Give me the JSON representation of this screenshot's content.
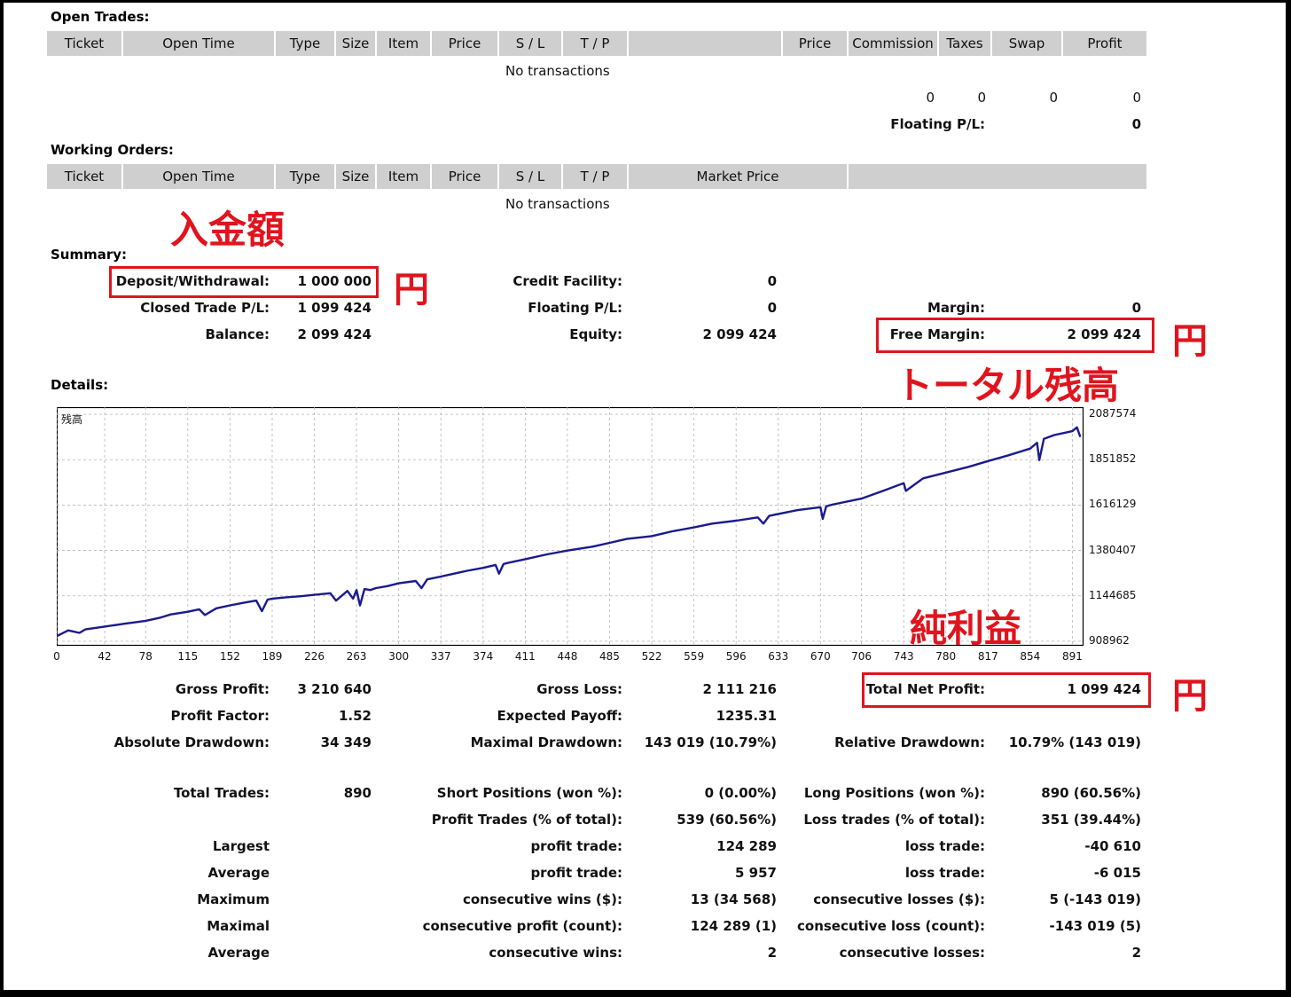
{
  "open_trades": {
    "title": "Open Trades:",
    "columns": [
      "Ticket",
      "Open Time",
      "Type",
      "Size",
      "Item",
      "Price",
      "S / L",
      "T / P",
      "",
      "Price",
      "Commission",
      "Taxes",
      "Swap",
      "Profit"
    ],
    "empty_text": "No transactions",
    "totals": [
      "0",
      "0",
      "0",
      "0"
    ],
    "floating_label": "Floating P/L:",
    "floating_value": "0"
  },
  "working_orders": {
    "title": "Working Orders:",
    "columns": [
      "Ticket",
      "Open Time",
      "Type",
      "Size",
      "Item",
      "Price",
      "S / L",
      "T / P",
      "Market Price",
      ""
    ],
    "empty_text": "No transactions"
  },
  "annotations": {
    "deposit_note": "入金額",
    "yen": "円",
    "total_balance_note": "トータル残高",
    "net_profit_note": "純利益"
  },
  "summary": {
    "title": "Summary:",
    "deposit_label": "Deposit/Withdrawal:",
    "deposit_value": "1 000 000",
    "closed_label": "Closed Trade P/L:",
    "closed_value": "1 099 424",
    "balance_label": "Balance:",
    "balance_value": "2 099 424",
    "credit_label": "Credit Facility:",
    "credit_value": "0",
    "floating_label": "Floating P/L:",
    "floating_value": "0",
    "equity_label": "Equity:",
    "equity_value": "2 099 424",
    "margin_label": "Margin:",
    "margin_value": "0",
    "free_margin_label": "Free Margin:",
    "free_margin_value": "2 099 424"
  },
  "details": {
    "title": "Details:",
    "chart_tag": "残高"
  },
  "chart_data": {
    "type": "line",
    "ylabel": "残高",
    "y_ticks": [
      2087574,
      1851852,
      1616129,
      1380407,
      1144685,
      908962
    ],
    "x_ticks": [
      0,
      42,
      78,
      115,
      152,
      189,
      226,
      263,
      300,
      337,
      374,
      411,
      448,
      485,
      522,
      559,
      596,
      633,
      670,
      706,
      743,
      780,
      817,
      854,
      891
    ],
    "xlim": [
      0,
      900
    ],
    "ylim": [
      890000,
      2125000
    ],
    "grid": true,
    "series": [
      {
        "color": "#1a1a8c",
        "x": [
          0,
          10,
          20,
          25,
          42,
          60,
          78,
          90,
          100,
          115,
          125,
          130,
          140,
          152,
          165,
          175,
          180,
          185,
          189,
          200,
          215,
          226,
          240,
          245,
          255,
          260,
          263,
          266,
          270,
          275,
          280,
          290,
          300,
          315,
          320,
          325,
          337,
          350,
          360,
          374,
          385,
          388,
          392,
          395,
          411,
          430,
          448,
          470,
          485,
          500,
          522,
          540,
          559,
          575,
          596,
          615,
          620,
          625,
          633,
          650,
          670,
          672,
          675,
          680,
          706,
          725,
          743,
          745,
          760,
          780,
          800,
          817,
          835,
          854,
          860,
          862,
          866,
          875,
          891,
          895,
          898
        ],
        "y": [
          935000,
          965000,
          952000,
          970000,
          985000,
          1000000,
          1015000,
          1030000,
          1048000,
          1062000,
          1075000,
          1045000,
          1080000,
          1095000,
          1110000,
          1120000,
          1065000,
          1125000,
          1130000,
          1136000,
          1143000,
          1150000,
          1158000,
          1120000,
          1170000,
          1130000,
          1175000,
          1095000,
          1180000,
          1175000,
          1185000,
          1195000,
          1210000,
          1222000,
          1185000,
          1230000,
          1245000,
          1262000,
          1275000,
          1290000,
          1305000,
          1260000,
          1310000,
          1315000,
          1335000,
          1360000,
          1380000,
          1400000,
          1420000,
          1440000,
          1455000,
          1480000,
          1500000,
          1520000,
          1535000,
          1552000,
          1520000,
          1560000,
          1570000,
          1590000,
          1605000,
          1545000,
          1610000,
          1618000,
          1650000,
          1690000,
          1730000,
          1690000,
          1755000,
          1785000,
          1815000,
          1845000,
          1875000,
          1910000,
          1940000,
          1850000,
          1960000,
          1980000,
          2000000,
          2020000,
          1970000
        ]
      }
    ]
  },
  "stats": {
    "gross_profit_label": "Gross Profit:",
    "gross_profit_value": "3 210 640",
    "gross_loss_label": "Gross Loss:",
    "gross_loss_value": "2 111 216",
    "net_profit_label": "Total Net Profit:",
    "net_profit_value": "1 099 424",
    "profit_factor_label": "Profit Factor:",
    "profit_factor_value": "1.52",
    "expected_payoff_label": "Expected Payoff:",
    "expected_payoff_value": "1235.31",
    "abs_dd_label": "Absolute Drawdown:",
    "abs_dd_value": "34 349",
    "max_dd_label": "Maximal Drawdown:",
    "max_dd_value": "143 019 (10.79%)",
    "rel_dd_label": "Relative Drawdown:",
    "rel_dd_value": "10.79% (143 019)",
    "total_trades_label": "Total Trades:",
    "total_trades_value": "890",
    "short_label": "Short Positions (won %):",
    "short_value": "0 (0.00%)",
    "long_label": "Long Positions (won %):",
    "long_value": "890 (60.56%)",
    "profit_trades_label": "Profit Trades (% of total):",
    "profit_trades_value": "539 (60.56%)",
    "loss_trades_label": "Loss trades (% of total):",
    "loss_trades_value": "351 (39.44%)",
    "largest_label": "Largest",
    "largest_profit_label": "profit trade:",
    "largest_profit_value": "124 289",
    "largest_loss_label": "loss trade:",
    "largest_loss_value": "-40 610",
    "average_label": "Average",
    "average_profit_label": "profit trade:",
    "average_profit_value": "5 957",
    "average_loss_label": "loss trade:",
    "average_loss_value": "-6 015",
    "maximum_label": "Maximum",
    "max_wins_label": "consecutive wins ($):",
    "max_wins_value": "13 (34 568)",
    "max_losses_label": "consecutive losses ($):",
    "max_losses_value": "5 (-143 019)",
    "maximal_label": "Maximal",
    "maximal_profit_label": "consecutive profit (count):",
    "maximal_profit_value": "124 289 (1)",
    "maximal_loss_label": "consecutive loss (count):",
    "maximal_loss_value": "-143 019 (5)",
    "average2_label": "Average",
    "avg_wins_label": "consecutive wins:",
    "avg_wins_value": "2",
    "avg_losses_label": "consecutive losses:",
    "avg_losses_value": "2"
  }
}
